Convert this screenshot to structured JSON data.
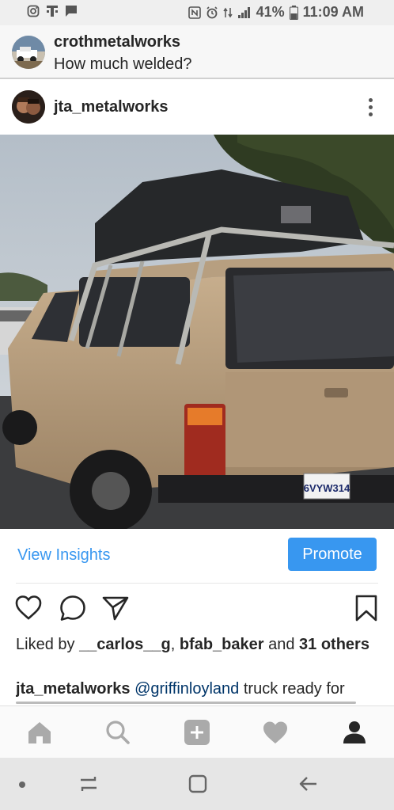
{
  "status_bar": {
    "battery": "41%",
    "time": "11:09 AM"
  },
  "comment_header": {
    "username": "crothmetalworks",
    "text": "How much welded?"
  },
  "post": {
    "username": "jta_metalworks",
    "license_plate": "6VYW314"
  },
  "insights": {
    "view_insights": "View Insights",
    "promote": "Promote"
  },
  "likes": {
    "prefix": "Liked by ",
    "user1": "__carlos__g",
    "separator": ", ",
    "user2": "bfab_baker",
    "and_text": " and ",
    "others": "31 others"
  },
  "caption": {
    "username": "jta_metalworks",
    "mention": "@griffinloyland",
    "text": " truck ready for"
  },
  "icons": {
    "like": "heart-icon",
    "comment": "comment-icon",
    "share": "send-icon",
    "save": "bookmark-icon",
    "more": "more-vertical-icon",
    "nav_home": "home-icon",
    "nav_search": "search-icon",
    "nav_add": "add-post-icon",
    "nav_activity": "heart-icon",
    "nav_profile": "profile-icon"
  },
  "colors": {
    "accent": "#3897f0",
    "text": "#262626",
    "mention": "#003569"
  }
}
